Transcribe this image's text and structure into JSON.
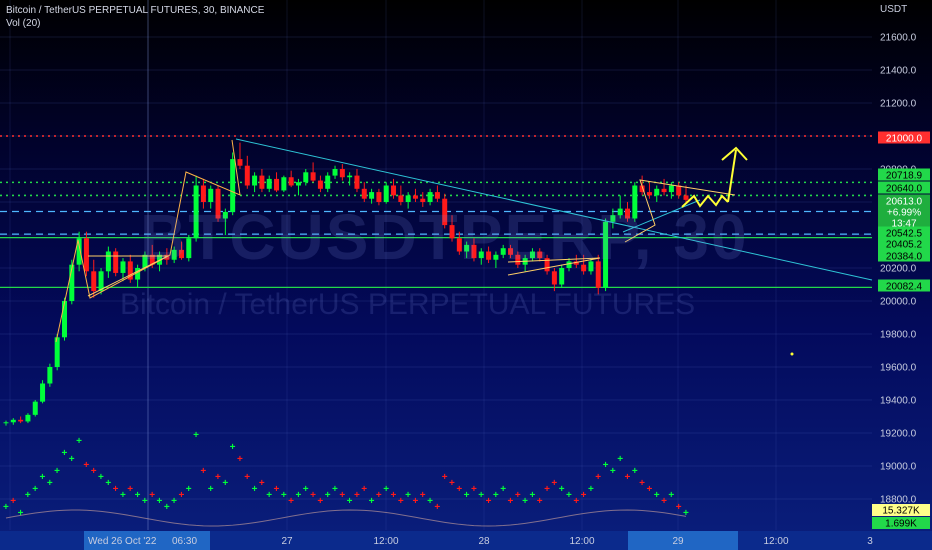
{
  "header": {
    "title": "Bitcoin / TetherUS PERPETUAL FUTURES, 30, BINANCE",
    "indicator": "Vol (20)"
  },
  "watermark": {
    "symbol": "BTCUSDTPERP, 30",
    "name": "Bitcoin / TetherUS PERPETUAL FUTURES"
  },
  "colors": {
    "up": "#00ff3a",
    "down": "#ff1a1a",
    "drawing_cyan": "#2ec4d6",
    "drawing_yellow": "#ffff33",
    "level_green": "#22d84a",
    "level_red": "#ff2f2f"
  },
  "chart_data": {
    "type": "candlestick",
    "axis_unit": "USDT",
    "ylim": [
      19000,
      21800
    ],
    "y_ticks": [
      18800,
      19000,
      19200,
      19400,
      19600,
      19800,
      20000,
      20200,
      20400,
      20600,
      20800,
      21000,
      21200,
      21400,
      21600
    ],
    "x_ticks": [
      "Wed 26 Oct '22",
      "06:30",
      "27",
      "12:00",
      "28",
      "12:00",
      "29",
      "12:00",
      "3"
    ],
    "price_labels": [
      {
        "value": "21000.0",
        "kind": "red"
      },
      {
        "value": "20718.9",
        "kind": "green"
      },
      {
        "value": "20640.0",
        "kind": "green"
      },
      {
        "value": "20613.0",
        "kind": "current"
      },
      {
        "value": "+6.99%",
        "kind": "current"
      },
      {
        "value": "13:47",
        "kind": "current"
      },
      {
        "value": "20542.5",
        "kind": "dash"
      },
      {
        "value": "20405.2",
        "kind": "dash"
      },
      {
        "value": "20384.0",
        "kind": "green"
      },
      {
        "value": "20082.4",
        "kind": "green"
      }
    ],
    "horizontal_levels": [
      {
        "price": 21000.0,
        "style": "red-dotted"
      },
      {
        "price": 20718.9,
        "style": "green-dotted"
      },
      {
        "price": 20640.0,
        "style": "green-dotted"
      },
      {
        "price": 20542.5,
        "style": "cyan-dashed"
      },
      {
        "price": 20405.2,
        "style": "cyan-dashed"
      },
      {
        "price": 20384.0,
        "style": "green-solid"
      },
      {
        "price": 20082.4,
        "style": "green-solid"
      }
    ],
    "volume_labels": [
      "15.327K",
      "1.699K"
    ],
    "candles": [
      [
        19260,
        19275,
        19245,
        19265
      ],
      [
        19265,
        19290,
        19250,
        19280
      ],
      [
        19280,
        19300,
        19260,
        19270
      ],
      [
        19270,
        19320,
        19260,
        19310
      ],
      [
        19310,
        19400,
        19300,
        19390
      ],
      [
        19390,
        19520,
        19380,
        19500
      ],
      [
        19500,
        19620,
        19480,
        19600
      ],
      [
        19600,
        19800,
        19580,
        19780
      ],
      [
        19780,
        20020,
        19760,
        20000
      ],
      [
        20000,
        20250,
        19980,
        20220
      ],
      [
        20220,
        20420,
        20180,
        20380
      ],
      [
        20380,
        20420,
        20150,
        20180
      ],
      [
        20180,
        20250,
        20020,
        20060
      ],
      [
        20060,
        20200,
        20040,
        20180
      ],
      [
        20180,
        20330,
        20140,
        20300
      ],
      [
        20300,
        20320,
        20150,
        20170
      ],
      [
        20170,
        20260,
        20120,
        20240
      ],
      [
        20240,
        20280,
        20110,
        20130
      ],
      [
        20130,
        20220,
        20080,
        20200
      ],
      [
        20200,
        20300,
        20180,
        20280
      ],
      [
        20280,
        20340,
        20200,
        20220
      ],
      [
        20220,
        20300,
        20180,
        20280
      ],
      [
        20280,
        20320,
        20220,
        20250
      ],
      [
        20250,
        20330,
        20230,
        20310
      ],
      [
        20310,
        20360,
        20250,
        20260
      ],
      [
        20260,
        20400,
        20240,
        20380
      ],
      [
        20380,
        20760,
        20360,
        20700
      ],
      [
        20700,
        20740,
        20560,
        20600
      ],
      [
        20600,
        20700,
        20560,
        20680
      ],
      [
        20680,
        20700,
        20480,
        20500
      ],
      [
        20500,
        20560,
        20400,
        20540
      ],
      [
        20540,
        20900,
        20520,
        20860
      ],
      [
        20860,
        20960,
        20800,
        20820
      ],
      [
        20820,
        20880,
        20680,
        20700
      ],
      [
        20700,
        20780,
        20660,
        20760
      ],
      [
        20760,
        20800,
        20660,
        20680
      ],
      [
        20680,
        20760,
        20660,
        20740
      ],
      [
        20740,
        20780,
        20660,
        20670
      ],
      [
        20670,
        20760,
        20660,
        20750
      ],
      [
        20750,
        20790,
        20690,
        20700
      ],
      [
        20700,
        20740,
        20640,
        20720
      ],
      [
        20720,
        20800,
        20700,
        20780
      ],
      [
        20780,
        20840,
        20720,
        20730
      ],
      [
        20730,
        20760,
        20660,
        20680
      ],
      [
        20680,
        20780,
        20660,
        20760
      ],
      [
        20760,
        20820,
        20740,
        20800
      ],
      [
        20800,
        20830,
        20730,
        20750
      ],
      [
        20750,
        20780,
        20700,
        20760
      ],
      [
        20760,
        20800,
        20660,
        20680
      ],
      [
        20680,
        20720,
        20600,
        20620
      ],
      [
        20620,
        20680,
        20590,
        20660
      ],
      [
        20660,
        20680,
        20580,
        20600
      ],
      [
        20600,
        20720,
        20590,
        20700
      ],
      [
        20700,
        20740,
        20620,
        20640
      ],
      [
        20640,
        20700,
        20580,
        20600
      ],
      [
        20600,
        20660,
        20560,
        20640
      ],
      [
        20640,
        20680,
        20600,
        20620
      ],
      [
        20620,
        20660,
        20570,
        20600
      ],
      [
        20600,
        20680,
        20580,
        20660
      ],
      [
        20660,
        20700,
        20600,
        20620
      ],
      [
        20620,
        20650,
        20440,
        20460
      ],
      [
        20460,
        20520,
        20360,
        20380
      ],
      [
        20380,
        20420,
        20280,
        20300
      ],
      [
        20300,
        20360,
        20260,
        20340
      ],
      [
        20340,
        20380,
        20240,
        20260
      ],
      [
        20260,
        20320,
        20220,
        20300
      ],
      [
        20300,
        20330,
        20230,
        20250
      ],
      [
        20250,
        20300,
        20200,
        20280
      ],
      [
        20280,
        20340,
        20260,
        20320
      ],
      [
        20320,
        20340,
        20260,
        20280
      ],
      [
        20280,
        20300,
        20200,
        20220
      ],
      [
        20220,
        20280,
        20180,
        20260
      ],
      [
        20260,
        20320,
        20240,
        20300
      ],
      [
        20300,
        20320,
        20240,
        20260
      ],
      [
        20260,
        20280,
        20160,
        20180
      ],
      [
        20180,
        20200,
        20060,
        20100
      ],
      [
        20100,
        20220,
        20080,
        20200
      ],
      [
        20200,
        20260,
        20180,
        20240
      ],
      [
        20240,
        20280,
        20200,
        20220
      ],
      [
        20220,
        20280,
        20160,
        20180
      ],
      [
        20180,
        20260,
        20160,
        20240
      ],
      [
        20240,
        20280,
        20040,
        20080
      ],
      [
        20080,
        20500,
        20060,
        20480
      ],
      [
        20480,
        20560,
        20440,
        20520
      ],
      [
        20520,
        20640,
        20500,
        20560
      ],
      [
        20560,
        20600,
        20480,
        20500
      ],
      [
        20500,
        20720,
        20480,
        20700
      ],
      [
        20700,
        20760,
        20640,
        20660
      ],
      [
        20660,
        20720,
        20620,
        20640
      ],
      [
        20640,
        20700,
        20600,
        20680
      ],
      [
        20680,
        20740,
        20640,
        20660
      ],
      [
        20660,
        20720,
        20620,
        20700
      ],
      [
        20700,
        20720,
        20620,
        20640
      ],
      [
        20640,
        20700,
        20600,
        20613
      ]
    ],
    "volume": [
      [
        3,
        1
      ],
      [
        4,
        0
      ],
      [
        2,
        1
      ],
      [
        5,
        1
      ],
      [
        6,
        1
      ],
      [
        8,
        1
      ],
      [
        7,
        1
      ],
      [
        9,
        1
      ],
      [
        12,
        1
      ],
      [
        11,
        1
      ],
      [
        14,
        1
      ],
      [
        10,
        0
      ],
      [
        9,
        0
      ],
      [
        8,
        1
      ],
      [
        7,
        1
      ],
      [
        6,
        0
      ],
      [
        5,
        1
      ],
      [
        6,
        0
      ],
      [
        5,
        1
      ],
      [
        4,
        1
      ],
      [
        5,
        0
      ],
      [
        4,
        1
      ],
      [
        3,
        1
      ],
      [
        4,
        1
      ],
      [
        5,
        0
      ],
      [
        6,
        1
      ],
      [
        15,
        1
      ],
      [
        9,
        0
      ],
      [
        6,
        1
      ],
      [
        8,
        0
      ],
      [
        7,
        1
      ],
      [
        13,
        1
      ],
      [
        11,
        0
      ],
      [
        8,
        0
      ],
      [
        6,
        1
      ],
      [
        7,
        0
      ],
      [
        5,
        1
      ],
      [
        6,
        0
      ],
      [
        5,
        1
      ],
      [
        4,
        0
      ],
      [
        5,
        1
      ],
      [
        6,
        1
      ],
      [
        5,
        0
      ],
      [
        4,
        0
      ],
      [
        5,
        1
      ],
      [
        6,
        1
      ],
      [
        5,
        0
      ],
      [
        4,
        1
      ],
      [
        5,
        0
      ],
      [
        6,
        0
      ],
      [
        4,
        1
      ],
      [
        5,
        0
      ],
      [
        6,
        1
      ],
      [
        5,
        0
      ],
      [
        4,
        0
      ],
      [
        5,
        1
      ],
      [
        4,
        0
      ],
      [
        5,
        0
      ],
      [
        4,
        1
      ],
      [
        3,
        0
      ],
      [
        8,
        0
      ],
      [
        7,
        0
      ],
      [
        6,
        0
      ],
      [
        5,
        1
      ],
      [
        6,
        0
      ],
      [
        5,
        1
      ],
      [
        4,
        0
      ],
      [
        5,
        1
      ],
      [
        6,
        1
      ],
      [
        4,
        0
      ],
      [
        5,
        0
      ],
      [
        4,
        1
      ],
      [
        5,
        1
      ],
      [
        4,
        0
      ],
      [
        6,
        0
      ],
      [
        7,
        0
      ],
      [
        6,
        1
      ],
      [
        5,
        1
      ],
      [
        4,
        0
      ],
      [
        5,
        0
      ],
      [
        6,
        1
      ],
      [
        8,
        0
      ],
      [
        10,
        1
      ],
      [
        9,
        1
      ],
      [
        11,
        1
      ],
      [
        8,
        0
      ],
      [
        9,
        1
      ],
      [
        7,
        0
      ],
      [
        6,
        0
      ],
      [
        5,
        1
      ],
      [
        4,
        0
      ],
      [
        5,
        1
      ],
      [
        3,
        0
      ],
      [
        2,
        1
      ]
    ]
  }
}
